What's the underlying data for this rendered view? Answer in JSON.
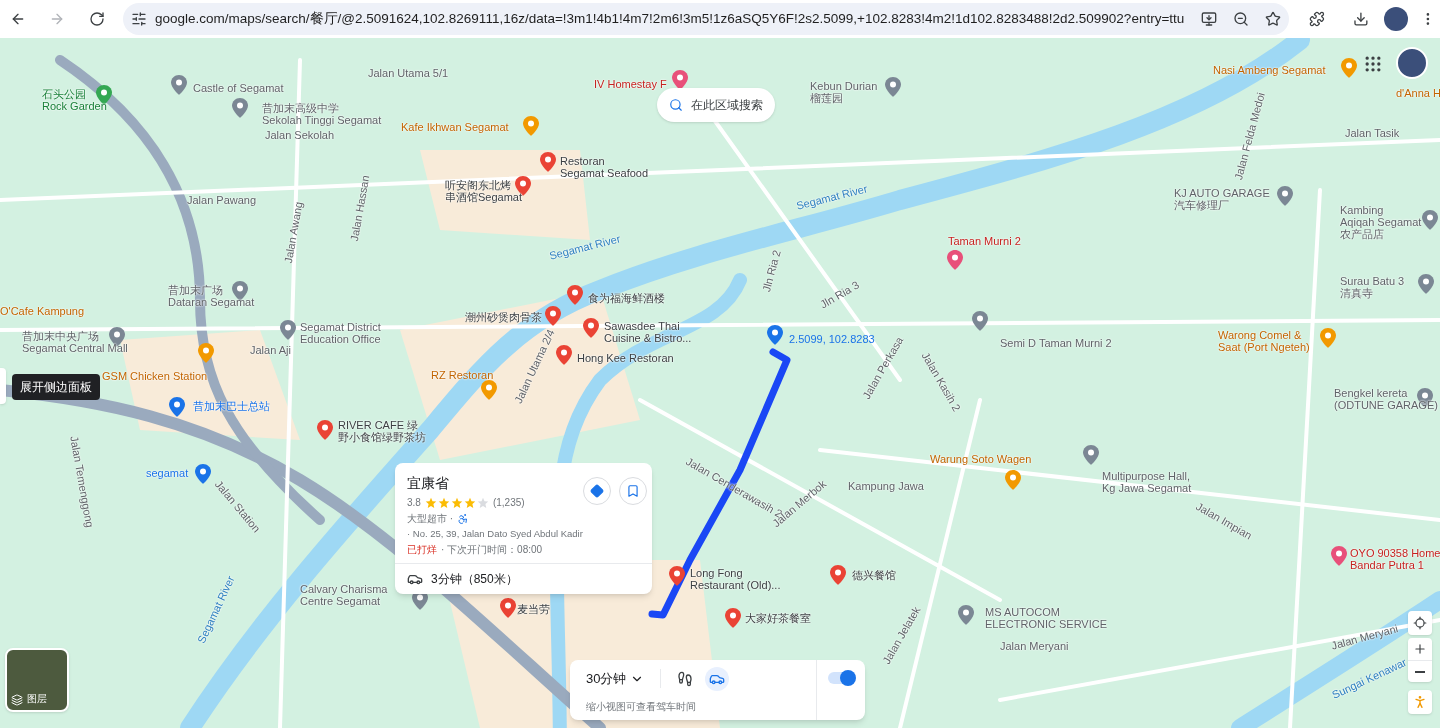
{
  "browser": {
    "url": "google.com/maps/search/餐厅/@2.5091624,102.8269111,16z/data=!3m1!4b1!4m7!2m6!3m5!1z6aSQ5Y6F!2s2.5099,+102.8283!4m2!1d102.8283488!2d2.509902?entry=ttu"
  },
  "map": {
    "search_area_button": "在此区域搜索",
    "sidebar_tooltip": "展开侧边面板",
    "pin_label": "2.5099, 102.8283",
    "layers_button": "图层",
    "labels": [
      {
        "kind": "place",
        "lines": [
          "Castle of Segamat"
        ]
      },
      {
        "kind": "park",
        "lines": [
          "石头公园",
          "Rock Garden"
        ]
      },
      {
        "kind": "place",
        "lines": [
          "昔加末高级中学",
          "Sekolah Tinggi Segamat"
        ]
      },
      {
        "kind": "street",
        "lines": [
          "Jalan Sekolah"
        ]
      },
      {
        "kind": "street",
        "lines": [
          "Jalan Utama 5/1"
        ]
      },
      {
        "kind": "hotel",
        "lines": [
          "IV Homestay F"
        ]
      },
      {
        "kind": "place",
        "lines": [
          "Kebun Durian",
          "榴莲园"
        ]
      },
      {
        "kind": "cafe",
        "lines": [
          "Nasi Ambeng Segamat"
        ]
      },
      {
        "kind": "cafe",
        "lines": [
          "d'Anna H"
        ]
      },
      {
        "kind": "street",
        "lines": [
          "Jalan Tasik"
        ]
      },
      {
        "kind": "cafe",
        "lines": [
          "Kafe Ikhwan Segamat"
        ]
      },
      {
        "kind": "restaurant",
        "lines": [
          "Restoran",
          "Segamat Seafood"
        ]
      },
      {
        "kind": "street",
        "lines": [
          "Jalan Pawang"
        ]
      },
      {
        "kind": "restaurant",
        "lines": [
          "听安阁东北烤",
          "串酒馆Segamat"
        ]
      },
      {
        "kind": "place",
        "lines": [
          "KJ AUTO GARAGE",
          "汽车修理厂"
        ]
      },
      {
        "kind": "place",
        "lines": [
          "Kambing",
          "Aqiqah Segamat",
          "农产品店"
        ]
      },
      {
        "kind": "river",
        "lines": [
          "Segamat River"
        ]
      },
      {
        "kind": "river",
        "lines": [
          "Segamat River"
        ]
      },
      {
        "kind": "hotel",
        "lines": [
          "Taman Murni 2"
        ]
      },
      {
        "kind": "place",
        "lines": [
          "昔加末广场",
          "Dataran Segamat"
        ]
      },
      {
        "kind": "cafe",
        "lines": [
          "O'Cafe Kampung"
        ]
      },
      {
        "kind": "restaurant",
        "lines": [
          "食为福海鲜酒楼"
        ]
      },
      {
        "kind": "place",
        "lines": [
          "Surau Batu 3",
          "清真寺"
        ]
      },
      {
        "kind": "restaurant",
        "lines": [
          "潮州砂煲肉骨茶"
        ]
      },
      {
        "kind": "place",
        "lines": [
          "Segamat District",
          "Education Office"
        ]
      },
      {
        "kind": "restaurant",
        "lines": [
          "Sawasdee Thai",
          "Cuisine & Bistro..."
        ]
      },
      {
        "kind": "place",
        "lines": [
          "昔加末中央广场",
          "Segamat Central Mall"
        ]
      },
      {
        "kind": "place",
        "lines": [
          "Semi D Taman Murni 2"
        ]
      },
      {
        "kind": "cafe",
        "lines": [
          "Warong Comel &",
          "Saat (Port Ngeteh)"
        ]
      },
      {
        "kind": "restaurant",
        "lines": [
          "Hong Kee Restoran"
        ]
      },
      {
        "kind": "street",
        "lines": [
          "Jalan Aji"
        ]
      },
      {
        "kind": "cafe",
        "lines": [
          "GSM Chicken Station"
        ]
      },
      {
        "kind": "cafe",
        "lines": [
          "RZ Restoran"
        ]
      },
      {
        "kind": "transit",
        "lines": [
          "昔加末巴士总站"
        ]
      },
      {
        "kind": "place",
        "lines": [
          "Bengkel kereta",
          "(ODTUNE GARAGE)"
        ]
      },
      {
        "kind": "restaurant",
        "lines": [
          "RIVER CAFE 绿",
          "野小食馆绿野茶坊"
        ]
      },
      {
        "kind": "transit",
        "lines": [
          "segamat"
        ]
      },
      {
        "kind": "place",
        "lines": [
          "Calvary Charisma",
          "Centre Segamat"
        ]
      },
      {
        "kind": "restaurant",
        "lines": [
          "麦当劳"
        ]
      },
      {
        "kind": "restaurant",
        "lines": [
          "Long Fong",
          "Restaurant (Old)..."
        ]
      },
      {
        "kind": "restaurant",
        "lines": [
          "德兴餐馆"
        ]
      },
      {
        "kind": "restaurant",
        "lines": [
          "大家好茶餐室"
        ]
      },
      {
        "kind": "place",
        "lines": [
          "MS AUTOCOM",
          "ELECTRONIC SERVICE"
        ]
      },
      {
        "kind": "hotel",
        "lines": [
          "OYO 90358 Home",
          "Bandar Putra 1"
        ]
      },
      {
        "kind": "street",
        "lines": [
          "Jalan Meryani"
        ]
      },
      {
        "kind": "cafe",
        "lines": [
          "Warung Soto Wagen"
        ]
      },
      {
        "kind": "area",
        "lines": [
          "Kampung Jawa"
        ]
      },
      {
        "kind": "place",
        "lines": [
          "Multipurpose Hall,",
          "Kg Jawa Segamat"
        ]
      },
      {
        "kind": "street",
        "lines": [
          "Jalan Utama 2/4"
        ]
      },
      {
        "kind": "street",
        "lines": [
          "Jalan Cenderawasih 2"
        ]
      },
      {
        "kind": "street",
        "lines": [
          "Jalan Perkasa"
        ]
      },
      {
        "kind": "street",
        "lines": [
          "Jalan Station"
        ]
      },
      {
        "kind": "street",
        "lines": [
          "Jalan Temenggong"
        ]
      },
      {
        "kind": "street",
        "lines": [
          "Jalan Awang"
        ]
      },
      {
        "kind": "street",
        "lines": [
          "Jalan Hassan"
        ]
      },
      {
        "kind": "street",
        "lines": [
          "Jalan Felda Medoi"
        ]
      },
      {
        "kind": "street",
        "lines": [
          "Jln Ria 2"
        ]
      },
      {
        "kind": "street",
        "lines": [
          "Jln Ria 3"
        ]
      },
      {
        "kind": "street",
        "lines": [
          "Jalan Merbok"
        ]
      },
      {
        "kind": "street",
        "lines": [
          "Jalan Jelatek"
        ]
      },
      {
        "kind": "street",
        "lines": [
          "Jalan Meryani"
        ]
      },
      {
        "kind": "river",
        "lines": [
          "Segamat River"
        ]
      },
      {
        "kind": "river",
        "lines": [
          "Sungai Kenawar"
        ]
      },
      {
        "kind": "street",
        "lines": [
          "Jalan Kasih 2"
        ]
      },
      {
        "kind": "street",
        "lines": [
          "Jalan Impian"
        ]
      }
    ]
  },
  "place_card": {
    "name": "宜康省",
    "rating": "3.8",
    "stars": 4,
    "reviews": "(1,235)",
    "category": "大型超市 ·",
    "address": "· No. 25, 39, Jalan Dato Syed Abdul Kadir",
    "status": "已打烊",
    "next_open": "· 下次开门时间：08:00",
    "travel": "3分钟（850米）"
  },
  "travel_panel": {
    "time": "30分钟",
    "hint": "缩小视图可查看驾车时间",
    "toggle_on": true,
    "modes": [
      {
        "kind": "walk",
        "selected": false
      },
      {
        "kind": "drive",
        "selected": true
      }
    ]
  }
}
